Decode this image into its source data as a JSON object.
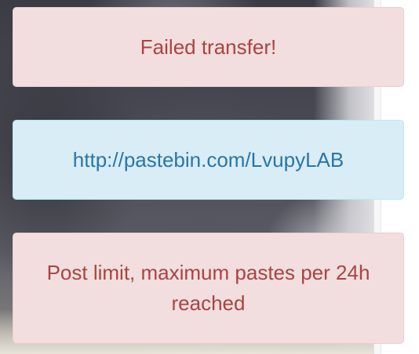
{
  "alerts": [
    {
      "type": "danger",
      "text": "Failed transfer!"
    },
    {
      "type": "info",
      "link_text": "http://pastebin.com/LvupyLAB"
    },
    {
      "type": "danger",
      "text": "Post limit, maximum pastes per 24h reached"
    }
  ],
  "colors": {
    "danger_bg": "#f2dede",
    "danger_text": "#a94442",
    "info_bg": "#d9edf7",
    "info_text": "#31708f"
  }
}
